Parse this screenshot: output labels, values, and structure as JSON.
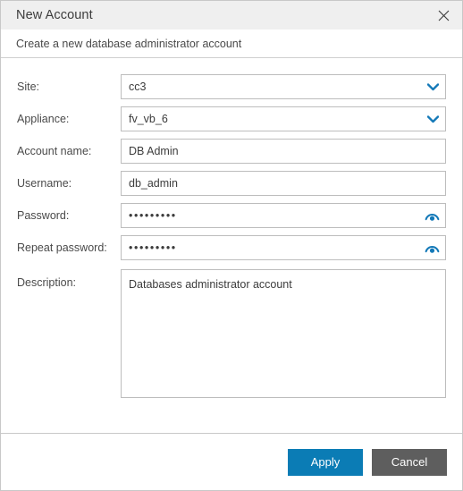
{
  "window": {
    "title": "New Account",
    "subtitle": "Create a new database administrator account",
    "close_icon": "close-icon"
  },
  "form": {
    "fields": [
      {
        "label": "Site:",
        "value": "cc3",
        "type": "select",
        "icon": "chevron-down-icon"
      },
      {
        "label": "Appliance:",
        "value": "fv_vb_6",
        "type": "select",
        "icon": "chevron-down-icon"
      },
      {
        "label": "Account name:",
        "value": "DB Admin",
        "type": "text"
      },
      {
        "label": "Username:",
        "value": "db_admin",
        "type": "text"
      },
      {
        "label": "Password:",
        "value": "•••••••••",
        "type": "password",
        "icon": "eye-icon"
      },
      {
        "label": "Repeat password:",
        "value": "•••••••••",
        "type": "password",
        "icon": "eye-icon"
      },
      {
        "label": "Description:",
        "value": "Databases administrator account",
        "type": "textarea"
      }
    ]
  },
  "footer": {
    "apply_label": "Apply",
    "cancel_label": "Cancel"
  },
  "colors": {
    "accent": "#0b7cb5",
    "cancel": "#5e5e5e",
    "titlebar": "#efefef",
    "border": "#bdbdbd"
  }
}
